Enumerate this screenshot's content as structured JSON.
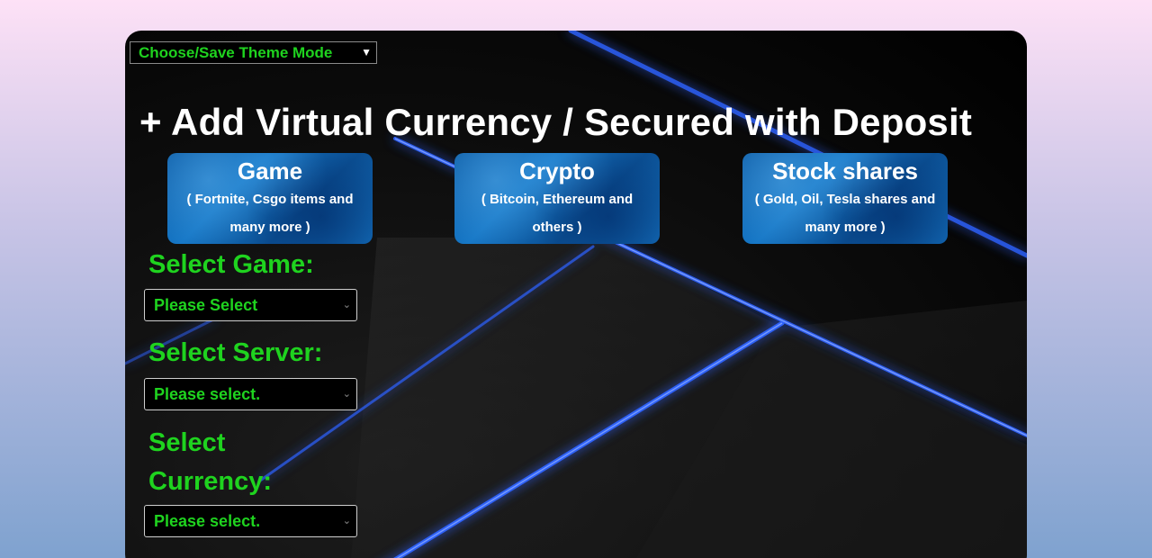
{
  "theme_mode": {
    "selected": "Choose/Save Theme Mode",
    "chevron_icon": "chevron-down-icon"
  },
  "page_title": "+ Add Virtual Currency / Secured with Deposit",
  "categories": [
    {
      "name": "Game",
      "description": "( Fortnite, Csgo items and many more )"
    },
    {
      "name": "Crypto",
      "description": "( Bitcoin, Ethereum and others )"
    },
    {
      "name": "Stock shares",
      "description": "( Gold, Oil, Tesla shares and many more )"
    }
  ],
  "form": {
    "game": {
      "label": "Select Game:",
      "value": "Please Select"
    },
    "server": {
      "label": "Select Server:",
      "value": "Please select."
    },
    "currency": {
      "label": "Select Currency:",
      "value": "Please select."
    }
  },
  "colors": {
    "accent_green": "#1fd31f",
    "card_blue": "#1677c6",
    "glow_blue": "#2a5cff"
  }
}
